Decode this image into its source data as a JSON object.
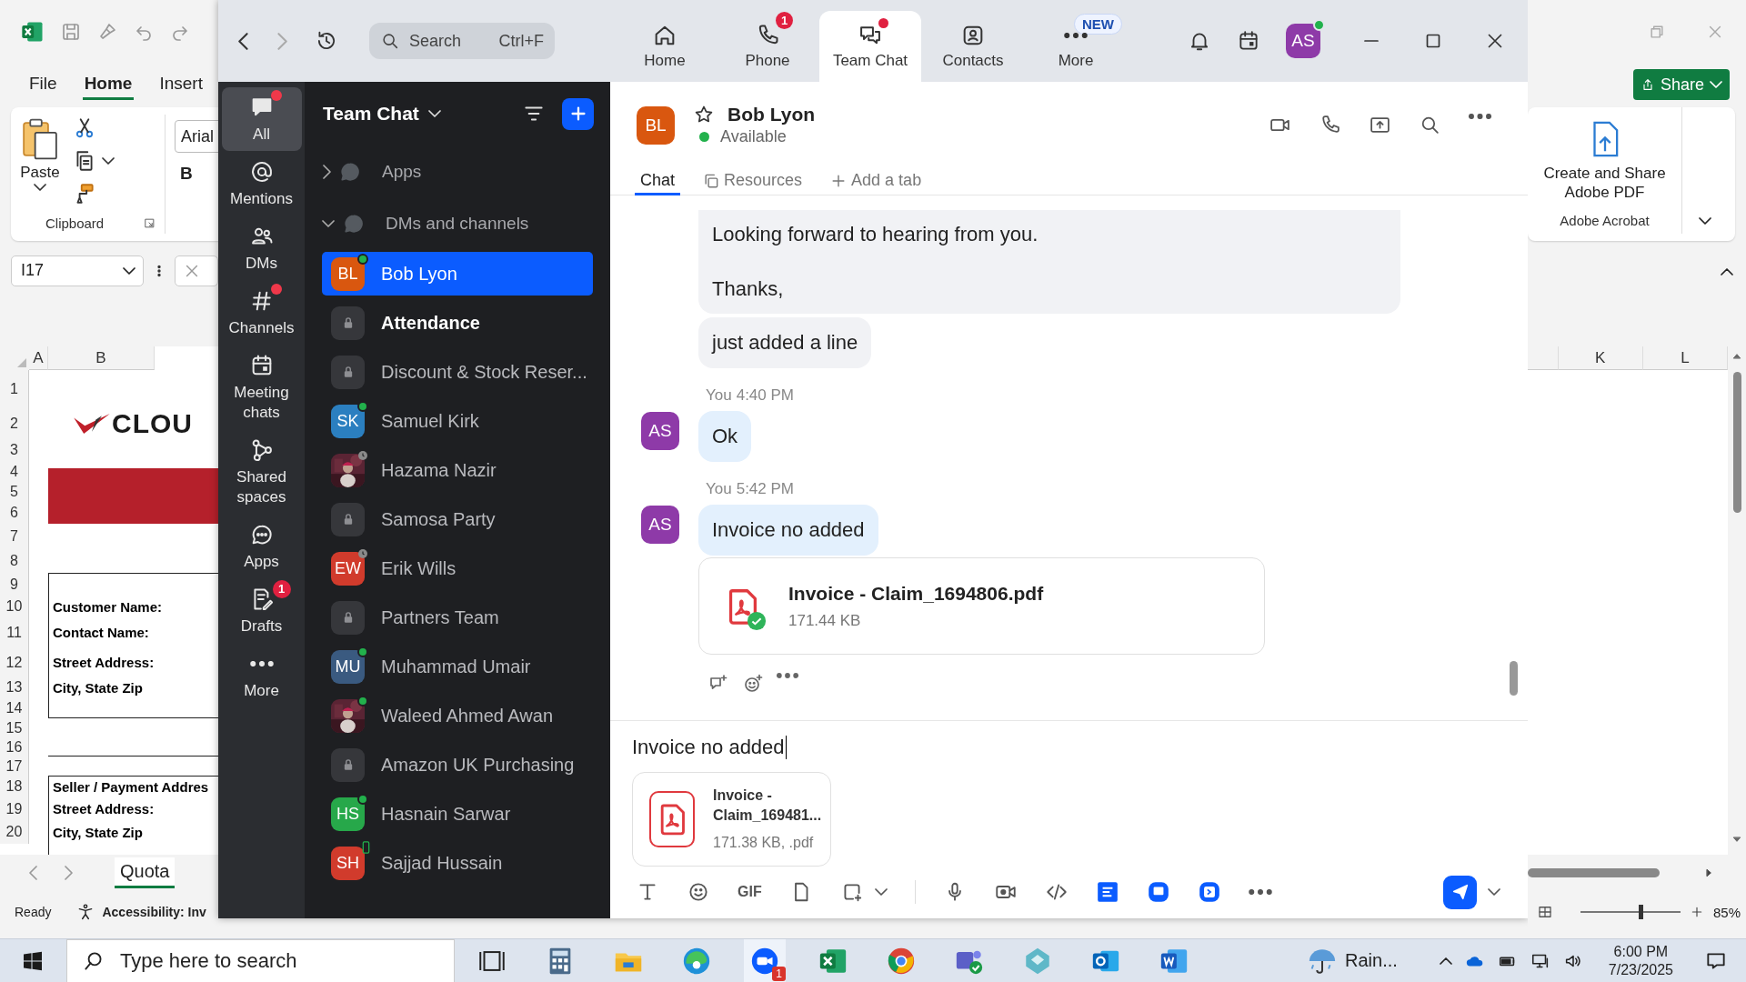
{
  "excel": {
    "ribbon_tabs": [
      {
        "label": "File",
        "selected": false
      },
      {
        "label": "Home",
        "selected": true
      },
      {
        "label": "Insert",
        "selected": false
      }
    ],
    "clipboard": {
      "paste_label": "Paste",
      "group_label": "Clipboard"
    },
    "font": {
      "name": "Arial",
      "bold_label": "B"
    },
    "name_box": "I17",
    "left_columns": [
      "A",
      "B"
    ],
    "rows": [
      "1",
      "2",
      "3",
      "4",
      "5",
      "6",
      "7",
      "8",
      "9",
      "10",
      "11",
      "12",
      "13",
      "14",
      "15",
      "16",
      "17",
      "18",
      "19",
      "20"
    ],
    "sheet": {
      "logo_text": "CLOU",
      "customer_fields": [
        "Customer Name:",
        "Contact Name:",
        "Street Address:",
        "City, State Zip"
      ],
      "seller_fields": [
        "Seller / Payment Addres",
        "Street Address:",
        "City, State Zip"
      ]
    },
    "sheet_tab": "Quota",
    "share_button": "Share",
    "acrobat": {
      "action_label": "Create and Share Adobe PDF",
      "group_label": "Adobe Acrobat"
    },
    "right_columns": [
      "K",
      "L"
    ],
    "status_bar": {
      "ready": "Ready",
      "accessibility": "Accessibility: Inv",
      "zoom_slider": {
        "level": 0.6
      },
      "zoom": "85%"
    }
  },
  "zoom_app": {
    "search": {
      "placeholder": "Search",
      "shortcut": "Ctrl+F"
    },
    "nav_tabs": [
      {
        "label": "Home",
        "selected": false
      },
      {
        "label": "Phone",
        "selected": false,
        "badge": "1"
      },
      {
        "label": "Team Chat",
        "selected": true,
        "dot": true
      },
      {
        "label": "Contacts",
        "selected": false
      },
      {
        "label": "More",
        "selected": false,
        "tag": "NEW"
      }
    ],
    "user_avatar": {
      "initials": "AS",
      "online": true
    },
    "rail": [
      {
        "label": "All",
        "selected": true,
        "dot": true
      },
      {
        "label": "Mentions",
        "selected": false
      },
      {
        "label": "DMs",
        "selected": false
      },
      {
        "label": "Channels",
        "selected": false,
        "dot": true
      },
      {
        "label": "Meeting chats",
        "selected": false
      },
      {
        "label": "Shared spaces",
        "selected": false
      },
      {
        "label": "Apps",
        "selected": false
      },
      {
        "label": "Drafts",
        "selected": false,
        "badge": "1"
      },
      {
        "label": "More",
        "selected": false
      }
    ],
    "panel_title": "Team Chat",
    "sections": [
      {
        "label": "Apps",
        "expanded": false
      },
      {
        "label": "DMs and channels",
        "expanded": true
      }
    ],
    "conversations": [
      {
        "kind": "person",
        "name": "Bob Lyon",
        "initials": "BL",
        "color": "#d9570f",
        "online": true,
        "away": false,
        "mobile": false,
        "selected": true,
        "unread": false
      },
      {
        "kind": "channel",
        "name": "Attendance",
        "online": false,
        "away": false,
        "mobile": false,
        "selected": false,
        "unread": true
      },
      {
        "kind": "channel",
        "name": "Discount & Stock Reser...",
        "online": false,
        "away": false,
        "mobile": false,
        "selected": false,
        "unread": false
      },
      {
        "kind": "person",
        "name": "Samuel Kirk",
        "initials": "SK",
        "color": "#2b7fc0",
        "online": true,
        "away": false,
        "mobile": false,
        "selected": false,
        "unread": false
      },
      {
        "name": "Hazama Nazir",
        "online": false,
        "away": true,
        "mobile": false,
        "selected": false,
        "unread": false
      },
      {
        "kind": "channel",
        "name": "Samosa Party",
        "online": false,
        "away": false,
        "mobile": false,
        "selected": false,
        "unread": false
      },
      {
        "kind": "person",
        "name": "Erik Wills",
        "initials": "EW",
        "color": "#d13b2c",
        "online": false,
        "away": true,
        "mobile": false,
        "selected": false,
        "unread": false
      },
      {
        "kind": "channel",
        "name": "Partners Team",
        "online": false,
        "away": false,
        "mobile": false,
        "selected": false,
        "unread": false
      },
      {
        "kind": "person",
        "name": "Muhammad Umair",
        "initials": "MU",
        "color": "#3a5a80",
        "online": true,
        "away": false,
        "mobile": false,
        "selected": false,
        "unread": false
      },
      {
        "name": "Waleed Ahmed Awan",
        "online": true,
        "away": false,
        "mobile": false,
        "selected": false,
        "unread": false
      },
      {
        "kind": "channel",
        "name": "Amazon UK Purchasing",
        "online": false,
        "away": false,
        "mobile": false,
        "selected": false,
        "unread": false
      },
      {
        "kind": "person",
        "name": "Hasnain Sarwar",
        "initials": "HS",
        "color": "#27a84a",
        "online": true,
        "away": false,
        "mobile": false,
        "selected": false,
        "unread": false
      },
      {
        "kind": "person",
        "name": "Sajjad Hussain",
        "initials": "SH",
        "color": "#d13b2c",
        "online": false,
        "away": false,
        "mobile": true,
        "selected": false,
        "unread": false
      }
    ],
    "chat": {
      "contact": {
        "initials": "BL",
        "color": "#d9570f",
        "name": "Bob Lyon",
        "starred": false,
        "status": "Available"
      },
      "tabs": [
        {
          "label": "Chat",
          "selected": true
        },
        {
          "label": "Resources",
          "selected": false
        },
        {
          "label": "Add a tab",
          "selected": false
        }
      ],
      "messages": [
        {
          "kind": "incoming",
          "lines": [
            "Looking forward to hearing from you.",
            "Thanks,"
          ]
        },
        {
          "kind": "incoming",
          "lines": [
            "just added a line"
          ]
        },
        {
          "kind": "outgoing",
          "sender": "You",
          "time": "4:40 PM",
          "initials": "AS",
          "text": "Ok"
        },
        {
          "kind": "outgoing",
          "sender": "You",
          "time": "5:42 PM",
          "initials": "AS",
          "text": "Invoice no added",
          "file": {
            "name": "Invoice - Claim_1694806.pdf",
            "size": "171.44 KB",
            "uploaded": true
          }
        }
      ],
      "composer": {
        "value": "Invoice no added",
        "attachment": {
          "name_lines": [
            "Invoice -",
            "Claim_169481..."
          ],
          "meta": "171.38 KB, .pdf"
        },
        "gif_label": "GIF"
      }
    }
  },
  "taskbar": {
    "search_placeholder": "Type here to search",
    "app_badge": "1",
    "weather": "Rain...",
    "time": "6:00 PM",
    "date": "7/23/2025"
  }
}
